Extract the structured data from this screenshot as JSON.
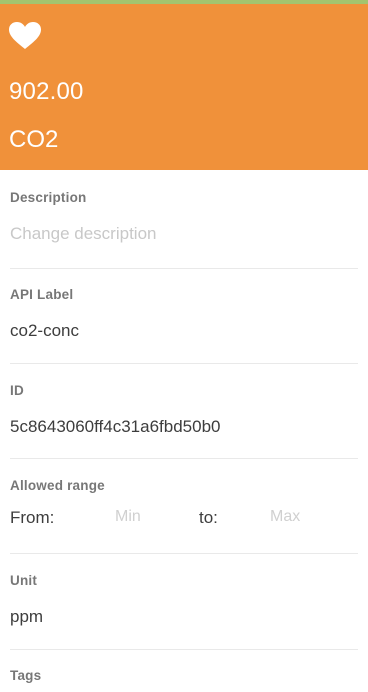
{
  "header": {
    "favorite_icon": "heart-icon",
    "value": "902.00",
    "name": "CO2",
    "background_color": "#f0913a",
    "strip_color": "#a3c46e"
  },
  "description": {
    "label": "Description",
    "placeholder": "Change description"
  },
  "api_label": {
    "label": "API Label",
    "value": "co2-conc"
  },
  "id": {
    "label": "ID",
    "value": "5c8643060ff4c31a6fbd50b0"
  },
  "allowed_range": {
    "label": "Allowed range",
    "from_label": "From:",
    "min_placeholder": "Min",
    "to_label": "to:",
    "max_placeholder": "Max"
  },
  "unit": {
    "label": "Unit",
    "value": "ppm"
  },
  "tags": {
    "label": "Tags"
  }
}
